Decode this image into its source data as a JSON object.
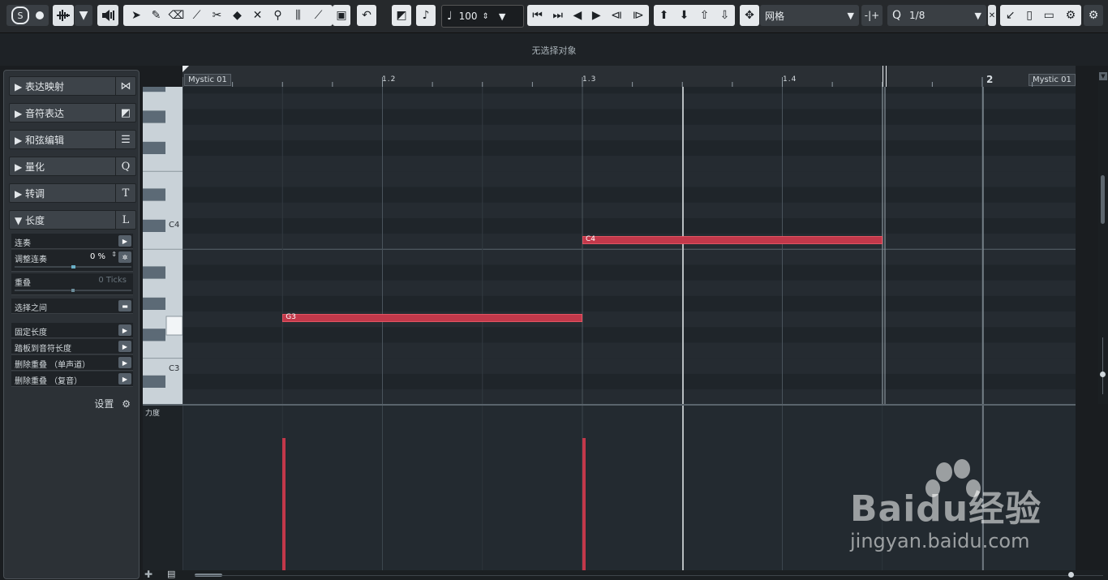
{
  "toolbar": {
    "velocity_value": "100",
    "snap_mode": "网格",
    "quantize_value": "1/8"
  },
  "infobar": {
    "status": "无选择对象"
  },
  "inspector": {
    "sections": [
      {
        "label": "▶ 表达映射",
        "icon": "expression-map-icon",
        "glyph": "⋈"
      },
      {
        "label": "▶ 音符表达",
        "icon": "note-expression-icon",
        "glyph": "◩"
      },
      {
        "label": "▶ 和弦编辑",
        "icon": "chord-edit-icon",
        "glyph": "☰"
      },
      {
        "label": "▶ 量化",
        "icon": "quantize-icon",
        "glyph": "Q"
      },
      {
        "label": "▶ 转调",
        "icon": "transpose-icon",
        "glyph": "T"
      },
      {
        "label": "▼ 长度",
        "icon": "length-icon",
        "glyph": "L"
      }
    ],
    "length": {
      "legato": "连奏",
      "adjust_legato": "调整连奏",
      "adjust_legato_value": "0 %",
      "overlap": "重叠",
      "overlap_value": "0 Ticks",
      "between_selected": "选择之间",
      "fixed_length": "固定长度",
      "pedal_to_length": "踏板到音符长度",
      "delete_overlap_mono": "删除重叠 （单声道）",
      "delete_overlap_poly": "删除重叠 （复音）"
    },
    "settings_label": "设置"
  },
  "ruler": {
    "part_name_left": "Mystic 01",
    "part_name_right": "Mystic 01",
    "ticks": [
      "1.2",
      "1.3",
      "1.4",
      "2"
    ]
  },
  "piano": {
    "c4": "C4",
    "c3": "C3"
  },
  "notes": [
    {
      "label": "G3",
      "start_beat": 1.5,
      "end_beat": 3.0,
      "velocity": 100
    },
    {
      "label": "C4",
      "start_beat": 3.0,
      "end_beat": 4.5,
      "velocity": 100
    }
  ],
  "velocity_lane": {
    "label": "力度"
  },
  "colors": {
    "note": "#c2384a",
    "note_border": "#e05563",
    "accent": "#3b8fd0"
  },
  "watermark": {
    "brand": "Baidu经验",
    "url": "jingyan.baidu.com"
  }
}
